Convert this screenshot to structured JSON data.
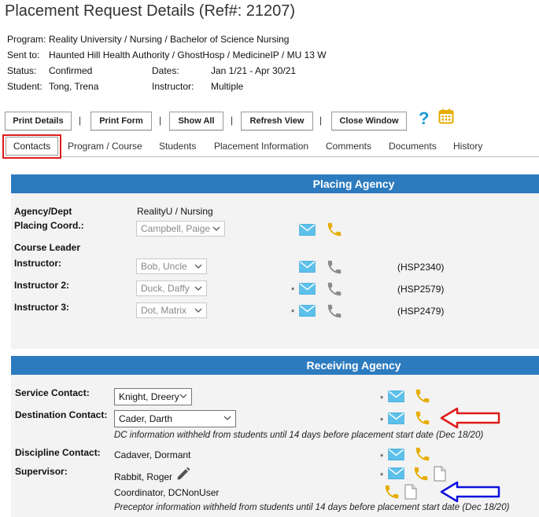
{
  "page": {
    "title": "Placement Request Details (Ref#: 21207)"
  },
  "summary": {
    "program_label": "Program:",
    "program_value": "Reality University / Nursing / Bachelor of Science Nursing",
    "sent_label": "Sent to:",
    "sent_value": "Haunted Hill Health Authority / GhostHosp / MedicineIP / MU 13 W",
    "status_label": "Status:",
    "status_value": "Confirmed",
    "dates_label": "Dates:",
    "dates_value": "Jan 1/21 - Apr 30/21",
    "student_label": "Student:",
    "student_value": "Tong, Trena",
    "instructor_label": "Instructor:",
    "instructor_value": "Multiple"
  },
  "toolbar": {
    "print_details": "Print Details",
    "print_form": "Print Form",
    "show_all": "Show All",
    "refresh_view": "Refresh View",
    "close_window": "Close Window",
    "separator": "|"
  },
  "tabs": [
    "Contacts",
    "Program / Course",
    "Students",
    "Placement Information",
    "Comments",
    "Documents",
    "History"
  ],
  "placing": {
    "header": "Placing Agency",
    "agency_label": "Agency/Dept",
    "agency_value": "RealityU / Nursing",
    "coord_label": "Placing Coord.:",
    "coord_value": "Campbell, Paige",
    "course_leader_label": "Course Leader",
    "instructor_label": "Instructor:",
    "instructor_value": "Bob, Uncle",
    "instructor_code": "(HSP2340)",
    "instructor2_label": "Instructor 2:",
    "instructor2_value": "Duck, Daffy",
    "instructor2_code": "(HSP2579)",
    "instructor3_label": "Instructor 3:",
    "instructor3_value": "Dot, Matrix",
    "instructor3_code": "(HSP2479)",
    "star": "*"
  },
  "receiving": {
    "header": "Receiving Agency",
    "service_label": "Service Contact:",
    "service_value": "Knight, Dreery",
    "destination_label": "Destination Contact:",
    "destination_value": "Cader, Darth",
    "dc_note": "DC information withheld from students until 14 days before placement start date (Dec 18/20)",
    "discipline_label": "Discipline Contact:",
    "discipline_value": "Cadaver, Dormant",
    "supervisor_label": "Supervisor:",
    "supervisor_value": "Rabbit, Roger",
    "coordinator_value": "Coordinator, DCNonUser",
    "preceptor_note": "Preceptor information withheld from students until 14 days before placement start date (Dec 18/20)",
    "star": "*"
  },
  "colors": {
    "header_blue": "#2d7bbf",
    "phone_gold": "#e6ac00",
    "phone_grey": "#8a8a8a",
    "mail_blue": "#5cc0ea",
    "red_arrow": "#e01b1b",
    "blue_arrow": "#1010e0"
  },
  "icons": {
    "help": "question-icon",
    "calendar": "calendar-icon",
    "mail": "mail-icon",
    "phone": "phone-icon",
    "doc": "document-icon",
    "pencil": "pencil-icon"
  }
}
